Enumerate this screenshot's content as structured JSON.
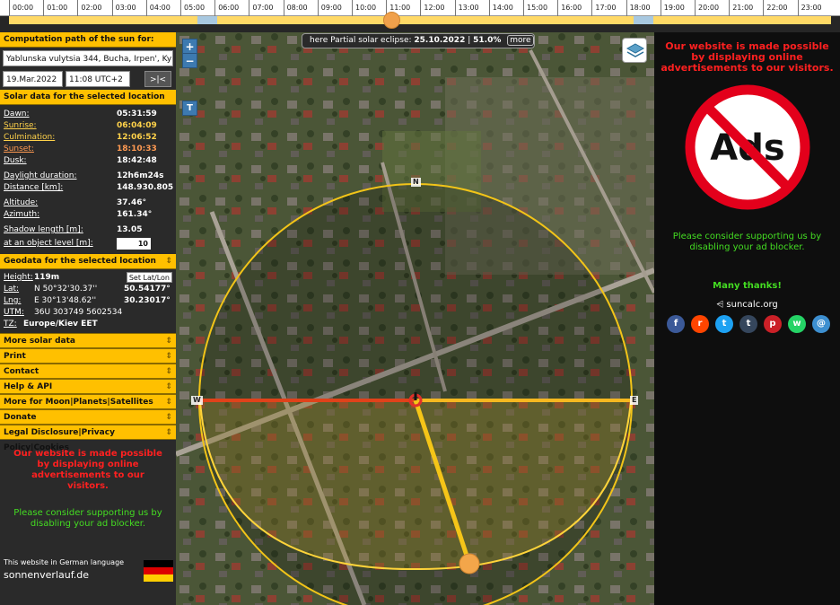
{
  "timeline": {
    "hours": [
      "00:00",
      "01:00",
      "02:00",
      "03:00",
      "04:00",
      "05:00",
      "06:00",
      "07:00",
      "08:00",
      "09:00",
      "10:00",
      "11:00",
      "12:00",
      "13:00",
      "14:00",
      "15:00",
      "16:00",
      "17:00",
      "18:00",
      "19:00",
      "20:00",
      "21:00",
      "22:00",
      "23:00"
    ],
    "current_time_fraction": 0.465
  },
  "left": {
    "comp_header": "Computation path of the sun for:",
    "address": "Yablunska vulytsia 344, Bucha, Irpen', Kyivska",
    "date": "19.Mar.2022",
    "time": "11:08 UTC+2",
    "now_button": ">|<",
    "solar_header": "Solar data for the selected location",
    "solar_rows": [
      {
        "k": "Dawn:",
        "v": "05:31:59",
        "kc": "#ffffff",
        "vc": "#ffffff"
      },
      {
        "k": "Sunrise:",
        "v": "06:04:09",
        "kc": "#ffd24a",
        "vc": "#ffd24a"
      },
      {
        "k": "Culmination:",
        "v": "12:06:52",
        "kc": "#ffd24a",
        "vc": "#ffd24a"
      },
      {
        "k": "Sunset:",
        "v": "18:10:33",
        "kc": "#ff9a52",
        "vc": "#ff9a52"
      },
      {
        "k": "Dusk:",
        "v": "18:42:48",
        "kc": "#ffffff",
        "vc": "#ffffff"
      }
    ],
    "daylight_label": "Daylight duration:",
    "daylight_value": "12h6m24s",
    "distance_label": "Distance [km]:",
    "distance_value": "148.930.805",
    "altitude_label": "Altitude:",
    "altitude_value": "37.46°",
    "azimuth_label": "Azimuth:",
    "azimuth_value": "161.34°",
    "shadow_label": "Shadow length [m]:",
    "shadow_value": "13.05",
    "level_label": "at an object level [m]:",
    "level_value": "10",
    "geo_header": "Geodata for the selected location",
    "height_label": "Height:",
    "height_value": "119m",
    "setlatlon": "Set Lat/Lon",
    "lat_label": "Lat:",
    "lat_dms": "N 50°32'30.37''",
    "lat_dec": "50.54177°",
    "lng_label": "Lng:",
    "lng_dms": "E 30°13'48.62''",
    "lng_dec": "30.23017°",
    "utm_label": "UTM:",
    "utm_value": "36U 303749 5602534",
    "tz_label": "TZ:",
    "tz_value": "Europe/Kiev  EET",
    "menu": [
      "More solar data",
      "Print",
      "Contact",
      "Help & API",
      "More for Moon|Planets|Satellites",
      "Donate",
      "Legal Disclosure|Privacy Policy|Cookies"
    ],
    "ad1": "Our website is made possible by displaying online advertisements to our visitors.",
    "ad2": "Please consider supporting us by disabling your ad blocker.",
    "lang_note": "This website in German language",
    "lang_site": "sonnenverlauf.de"
  },
  "map": {
    "zoom_in": "+",
    "zoom_out": "−",
    "t_button": "T",
    "eclipse_prefix": "here Partial solar eclipse:",
    "eclipse_date": "25.10.2022",
    "eclipse_pct": "51.0%",
    "eclipse_more": "more",
    "compass_n": "N",
    "compass_w": "W",
    "compass_e": "E"
  },
  "right": {
    "ad1": "Our website is made possible by displaying online advertisements to our visitors.",
    "noads_text": "Ads",
    "ad2": "Please consider supporting us by disabling your ad blocker.",
    "thanks": "Many thanks!",
    "site": "suncalc.org",
    "social": [
      {
        "name": "facebook-icon",
        "glyph": "f",
        "color": "#3b5998"
      },
      {
        "name": "reddit-icon",
        "glyph": "r",
        "color": "#ff4500"
      },
      {
        "name": "twitter-icon",
        "glyph": "t",
        "color": "#1da1f2"
      },
      {
        "name": "tumblr-icon",
        "glyph": "t",
        "color": "#35465c"
      },
      {
        "name": "pinterest-icon",
        "glyph": "p",
        "color": "#cb2027"
      },
      {
        "name": "whatsapp-icon",
        "glyph": "w",
        "color": "#25d366"
      },
      {
        "name": "email-icon",
        "glyph": "@",
        "color": "#3d8fd0"
      }
    ]
  }
}
